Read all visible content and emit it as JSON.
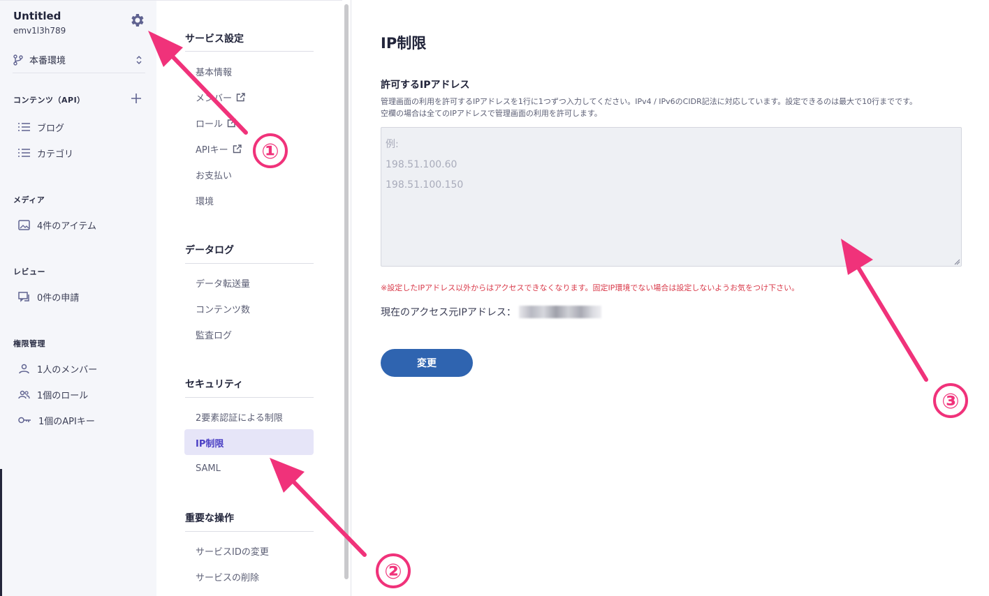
{
  "project": {
    "title": "Untitled",
    "id": "emv1l3h789"
  },
  "environment": {
    "label": "本番環境"
  },
  "sidebar": {
    "sections": [
      {
        "heading": "コンテンツ（API）",
        "items": [
          {
            "label": "ブログ",
            "icon": "list-icon"
          },
          {
            "label": "カテゴリ",
            "icon": "list-icon"
          }
        ]
      },
      {
        "heading": "メディア",
        "items": [
          {
            "label": "4件のアイテム",
            "icon": "image-icon"
          }
        ]
      },
      {
        "heading": "レビュー",
        "items": [
          {
            "label": "0件の申請",
            "icon": "review-icon"
          }
        ]
      },
      {
        "heading": "権限管理",
        "items": [
          {
            "label": "1人のメンバー",
            "icon": "user-icon"
          },
          {
            "label": "1個のロール",
            "icon": "users-icon"
          },
          {
            "label": "1個のAPIキー",
            "icon": "key-icon"
          }
        ]
      }
    ]
  },
  "menu": {
    "groups": [
      {
        "heading": "サービス設定",
        "items": [
          {
            "label": "基本情報"
          },
          {
            "label": "メンバー",
            "external": true
          },
          {
            "label": "ロール",
            "external": true
          },
          {
            "label": "APIキー",
            "external": true
          },
          {
            "label": "お支払い"
          },
          {
            "label": "環境"
          }
        ]
      },
      {
        "heading": "データログ",
        "items": [
          {
            "label": "データ転送量"
          },
          {
            "label": "コンテンツ数"
          },
          {
            "label": "監査ログ"
          }
        ]
      },
      {
        "heading": "セキュリティ",
        "items": [
          {
            "label": "2要素認証による制限"
          },
          {
            "label": "IP制限",
            "active": true
          },
          {
            "label": "SAML"
          }
        ]
      },
      {
        "heading": "重要な操作",
        "items": [
          {
            "label": "サービスIDの変更"
          },
          {
            "label": "サービスの削除"
          }
        ]
      }
    ]
  },
  "main": {
    "title": "IP制限",
    "field_label": "許可するIPアドレス",
    "description_line1": "管理画面の利用を許可するIPアドレスを1行に1つずつ入力してください。IPv4 / IPv6のCIDR記法に対応しています。設定できるのは最大で10行までです。",
    "description_line2": "空欄の場合は全てのIPアドレスで管理画面の利用を許可します。",
    "textarea_placeholder": "例:\n198.51.100.60\n198.51.100.150",
    "warning": "※設定したIPアドレス以外からはアクセスできなくなります。固定IP環境でない場合は設定しないようお気をつけ下さい。",
    "current_ip_label": "現在のアクセス元IPアドレス：",
    "submit_label": "変更"
  },
  "annotations": {
    "color": "#f0327a",
    "labels": [
      "①",
      "②",
      "③"
    ]
  }
}
